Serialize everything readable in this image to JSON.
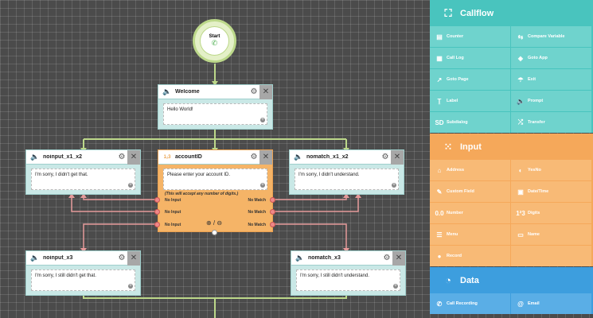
{
  "start": {
    "label": "Start",
    "icon": "phone-icon"
  },
  "nodes": {
    "welcome": {
      "title": "Welcome",
      "text": "Hello World!"
    },
    "noinput_x1_x2": {
      "title": "noinput_x1_x2",
      "text": "I'm sorry, I didn't get that."
    },
    "accountID": {
      "title": "accountID",
      "text": "Please enter your account ID.",
      "note": "(This will accept any number of digits.)",
      "left_ports": [
        "No Input",
        "No Input",
        "No Input"
      ],
      "right_ports": [
        "No Match",
        "No Match",
        "No Match"
      ]
    },
    "nomatch_x1_x2": {
      "title": "nomatch_x1_x2",
      "text": "I'm sorry, I didn't understand."
    },
    "noinput_x3": {
      "title": "noinput_x3",
      "text": "I'm sorry, I still didn't get that."
    },
    "nomatch_x3": {
      "title": "nomatch_x3",
      "text": "I'm sorry, I still didn't understand."
    }
  },
  "sidebar": {
    "callflow": {
      "title": "Callflow",
      "color": "#49c4be",
      "items": [
        {
          "label": "Counter",
          "icon": "counter-icon"
        },
        {
          "label": "Compare Variable",
          "icon": "compare-icon"
        },
        {
          "label": "Call Log",
          "icon": "log-icon"
        },
        {
          "label": "Goto App",
          "icon": "goto-app-icon"
        },
        {
          "label": "Goto Page",
          "icon": "goto-page-icon"
        },
        {
          "label": "Exit",
          "icon": "exit-icon"
        },
        {
          "label": "Label",
          "icon": "label-icon"
        },
        {
          "label": "Prompt",
          "icon": "prompt-icon"
        },
        {
          "label": "Subdialog",
          "icon": "subdialog-icon"
        },
        {
          "label": "Transfer",
          "icon": "transfer-icon"
        }
      ]
    },
    "input": {
      "title": "Input",
      "color": "#f5a85a",
      "items": [
        {
          "label": "Address",
          "icon": "home-icon"
        },
        {
          "label": "YesNo",
          "icon": "toggle-icon"
        },
        {
          "label": "Custom Field",
          "icon": "edit-icon"
        },
        {
          "label": "Date/Time",
          "icon": "calendar-icon"
        },
        {
          "label": "Number",
          "icon": "number-icon"
        },
        {
          "label": "Digits",
          "icon": "digits-icon"
        },
        {
          "label": "Menu",
          "icon": "menu-icon"
        },
        {
          "label": "Name",
          "icon": "name-icon"
        },
        {
          "label": "Record",
          "icon": "record-icon"
        },
        {
          "label": "",
          "icon": ""
        }
      ]
    },
    "data": {
      "title": "Data",
      "color": "#3d9ede",
      "items": [
        {
          "label": "Call Recording",
          "icon": "call-recording-icon"
        },
        {
          "label": "Email",
          "icon": "email-icon"
        }
      ]
    }
  }
}
